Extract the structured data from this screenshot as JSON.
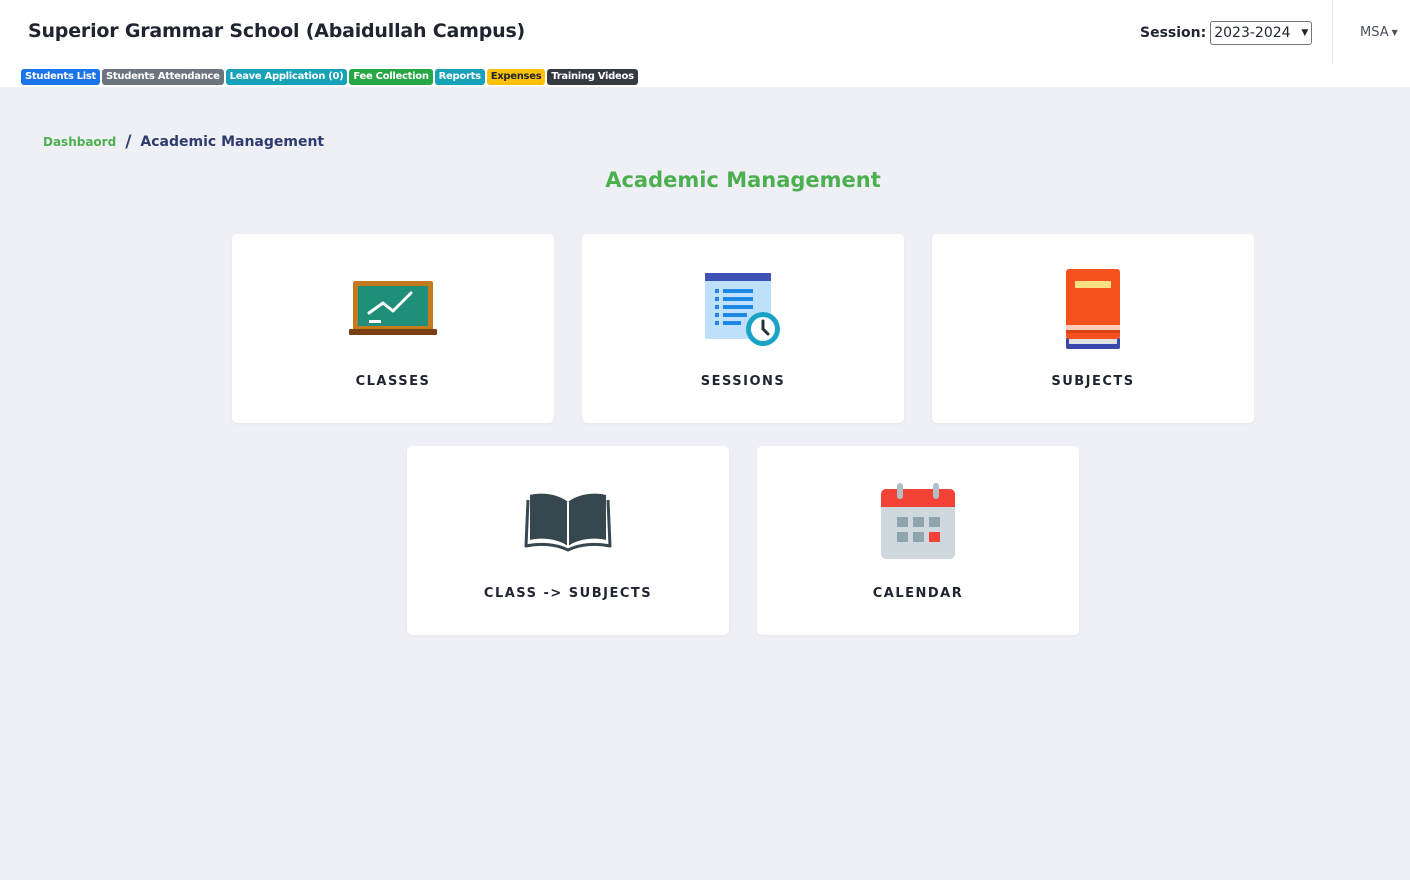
{
  "header": {
    "school_name": "Superior Grammar School (Abaidullah Campus)",
    "session_label": "Session:",
    "session_value": "2023-2024",
    "user": "MSA"
  },
  "quick_links": [
    {
      "label": "Students List",
      "color": "#1a73e8"
    },
    {
      "label": "Students Attendance",
      "color": "#6c757d"
    },
    {
      "label": "Leave Application (0)",
      "color": "#17a2b8"
    },
    {
      "label": "Fee Collection",
      "color": "#28a745"
    },
    {
      "label": "Reports",
      "color": "#17a2b8"
    },
    {
      "label": "Expenses",
      "color": "#ffc107"
    },
    {
      "label": "Training Videos",
      "color": "#343a40"
    }
  ],
  "breadcrumb": {
    "home": "Dashbaord",
    "separator": "/",
    "current": "Academic Management"
  },
  "page_title": "Academic Management",
  "cards": [
    {
      "label": "CLASSES",
      "icon": "chalkboard-icon"
    },
    {
      "label": "SESSIONS",
      "icon": "schedule-list-clock-icon"
    },
    {
      "label": "SUBJECTS",
      "icon": "book-stack-icon"
    },
    {
      "label": "CLASS -> SUBJECTS",
      "icon": "open-book-icon"
    },
    {
      "label": "CALENDAR",
      "icon": "calendar-icon"
    }
  ],
  "colors": {
    "accent_green": "#4caf50",
    "breadcrumb_navy": "#2f3a6e",
    "background": "#eff0f5"
  }
}
